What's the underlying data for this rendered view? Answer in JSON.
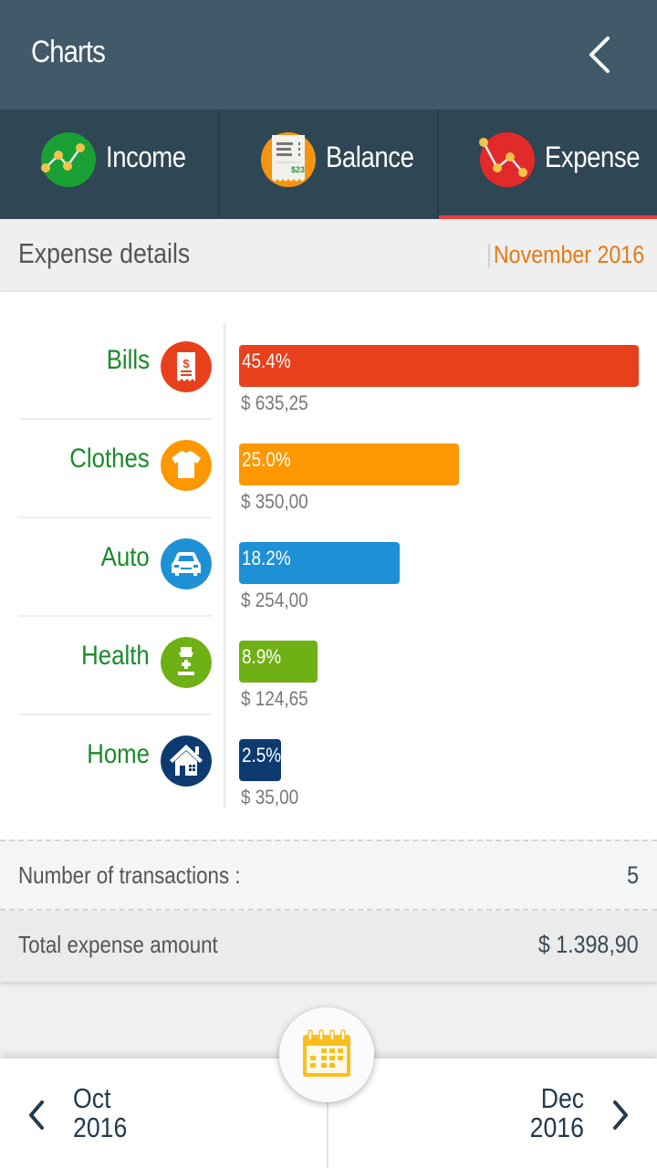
{
  "appbar": {
    "title": "Charts",
    "back_icon": "chevron-left-icon"
  },
  "tabs": [
    {
      "label": "Income",
      "icon": "income-chart-icon",
      "active": false
    },
    {
      "label": "Balance",
      "icon": "receipt-icon",
      "active": false
    },
    {
      "label": "Expense",
      "icon": "expense-chart-icon",
      "active": true
    }
  ],
  "subheader": {
    "title": "Expense details",
    "period": "November 2016"
  },
  "colors": {
    "category_label": "#1a8a2a",
    "period": "#e57a14",
    "active_tab_underline": "#f03a3a"
  },
  "chart_data": {
    "type": "bar",
    "orientation": "horizontal",
    "title": "Expense details",
    "period": "November 2016",
    "categories": [
      "Bills",
      "Clothes",
      "Auto",
      "Health",
      "Home"
    ],
    "values": [
      635.25,
      350.0,
      254.0,
      124.65,
      35.0
    ],
    "percentages": [
      45.4,
      25.0,
      18.2,
      8.9,
      2.5
    ],
    "value_labels": [
      "$ 635,25",
      "$ 350,00",
      "$ 254,00",
      "$ 124,65",
      "$ 35,00"
    ],
    "percent_labels": [
      "45.4%",
      "25.0%",
      "18.2%",
      "8.9%",
      "2.5%"
    ],
    "bar_colors": [
      "#e8401c",
      "#ff9800",
      "#1e90d6",
      "#6fb015",
      "#0d3b70"
    ],
    "icons": [
      "bill-receipt-icon",
      "tshirt-icon",
      "car-icon",
      "medicine-bottle-icon",
      "house-icon"
    ],
    "grid": false,
    "legend": "none"
  },
  "stats": {
    "transactions_label": "Number of transactions :",
    "transactions_value": "5",
    "total_label": "Total expense amount",
    "total_value": "$ 1.398,90"
  },
  "bottom_nav": {
    "prev": {
      "month": "Oct",
      "year": "2016"
    },
    "next": {
      "month": "Dec",
      "year": "2016"
    },
    "calendar_icon": "calendar-icon"
  }
}
